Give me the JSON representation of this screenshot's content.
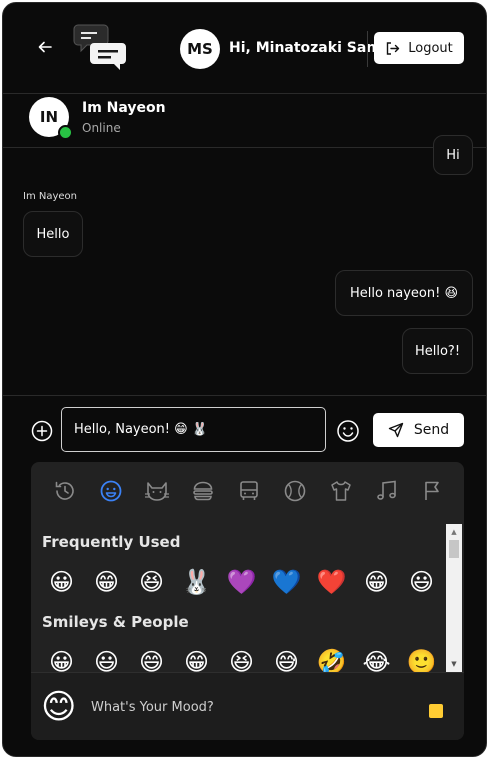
{
  "header": {
    "user_initials": "MS",
    "greeting": "Hi, Minatozaki Sana!",
    "logout_label": "Logout"
  },
  "contact": {
    "initials": "IN",
    "name": "Im Nayeon",
    "status": "Online"
  },
  "messages": [
    {
      "direction": "outgoing",
      "text": "Hi"
    },
    {
      "direction": "incoming",
      "sender": "Im Nayeon",
      "text": "Hello"
    },
    {
      "direction": "outgoing",
      "text": "Hello nayeon! 😆"
    },
    {
      "direction": "outgoing",
      "text": "Hello?!"
    }
  ],
  "composer": {
    "input_value": "Hello, Nayeon! 😁 🐰",
    "send_label": "Send"
  },
  "emoji_picker": {
    "categories": [
      "recent-icon",
      "smileys-icon",
      "animals-icon",
      "food-icon",
      "travel-icon",
      "activities-icon",
      "objects-icon",
      "symbols-icon",
      "flags-icon"
    ],
    "active_category": "smileys",
    "sections": [
      {
        "title": "Frequently Used",
        "emojis": [
          "😀",
          "😁",
          "😆",
          "🐰",
          "💜",
          "💙",
          "❤️",
          "😁",
          "😃"
        ]
      },
      {
        "title": "Smileys & People",
        "emojis": [
          "😀",
          "😃",
          "😄",
          "😁",
          "😆",
          "😅",
          "🤣",
          "😂",
          "🙂"
        ]
      }
    ],
    "footer_emoji": "😊",
    "footer_text": "What's Your Mood?",
    "skin_tone_color": "#ffcc33"
  },
  "colors": {
    "background": "#0b0b0b",
    "online": "#28c244",
    "picker_bg": "#222222",
    "active_category": "#3b82f6"
  }
}
